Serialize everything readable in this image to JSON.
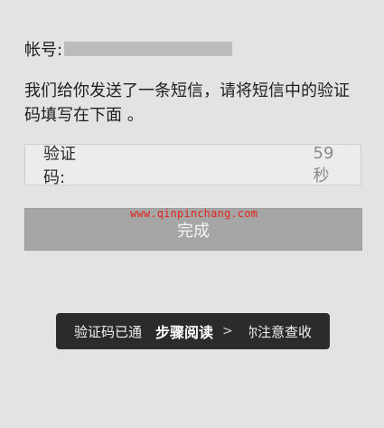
{
  "account": {
    "label": "帐号:"
  },
  "instruction": "我们给你发送了一条短信，请将短信中的验证码填写在下面 。",
  "code_field": {
    "label": "验证码:",
    "value": "",
    "countdown": "59秒"
  },
  "done_button": "完成",
  "watermark": "www.qinpinchang.com",
  "toast": {
    "left": "验证码已通",
    "overlay": "步骤阅读",
    "overlay_arrow": ">",
    "right": "你注意查收"
  }
}
